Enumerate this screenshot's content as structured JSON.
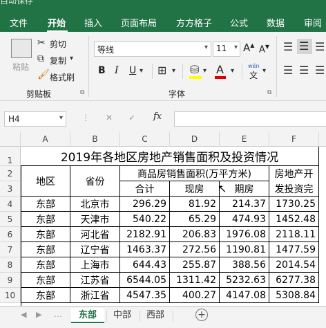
{
  "titlebar": {
    "text": "自动保存"
  },
  "tabs": [
    "文件",
    "开始",
    "插入",
    "页面布局",
    "方方格子",
    "公式",
    "数据",
    "审阅"
  ],
  "ribbon": {
    "paste": "粘贴",
    "cut": "剪切",
    "copy": "复制",
    "format_painter": "格式刷",
    "clipboard_group": "剪贴板",
    "font_name": "等线",
    "font_size": "11",
    "font_group": "字体",
    "bold": "B",
    "italic": "I",
    "underline": "U",
    "wen": "wén"
  },
  "formula": {
    "cell_ref": "H4",
    "fx": "fx",
    "cancel": "✕",
    "enter": "✓"
  },
  "columns": [
    "A",
    "B",
    "C",
    "D",
    "E",
    "F"
  ],
  "rows": [
    "1",
    "2",
    "3",
    "4",
    "5",
    "6",
    "7",
    "8",
    "9",
    "10"
  ],
  "table": {
    "title": "2019年各地区房地产销售面积及投资情况",
    "h_region": "地区",
    "h_province": "省份",
    "h_sales": "商品房销售面积(万平方米)",
    "h_invest_top": "房地产开",
    "h_total": "合计",
    "h_current": "现房",
    "h_future": "期房",
    "h_invest_bottom": "发投资完",
    "data": [
      [
        "东部",
        "北京市",
        "296.29",
        "81.92",
        "214.37",
        "1730.25"
      ],
      [
        "东部",
        "天津市",
        "540.22",
        "65.29",
        "474.93",
        "1452.48"
      ],
      [
        "东部",
        "河北省",
        "2182.91",
        "206.83",
        "1976.08",
        "2118.11"
      ],
      [
        "东部",
        "辽宁省",
        "1463.37",
        "272.56",
        "1190.81",
        "1477.59"
      ],
      [
        "东部",
        "上海市",
        "644.43",
        "255.87",
        "388.56",
        "2014.54"
      ],
      [
        "东部",
        "江苏省",
        "6544.05",
        "1311.42",
        "5232.63",
        "6277.38"
      ],
      [
        "东部",
        "浙江省",
        "4547.35",
        "400.27",
        "4147.08",
        "5308.84"
      ]
    ]
  },
  "sheets": [
    "东部",
    "中部",
    "西部"
  ],
  "add_sheet": "+"
}
